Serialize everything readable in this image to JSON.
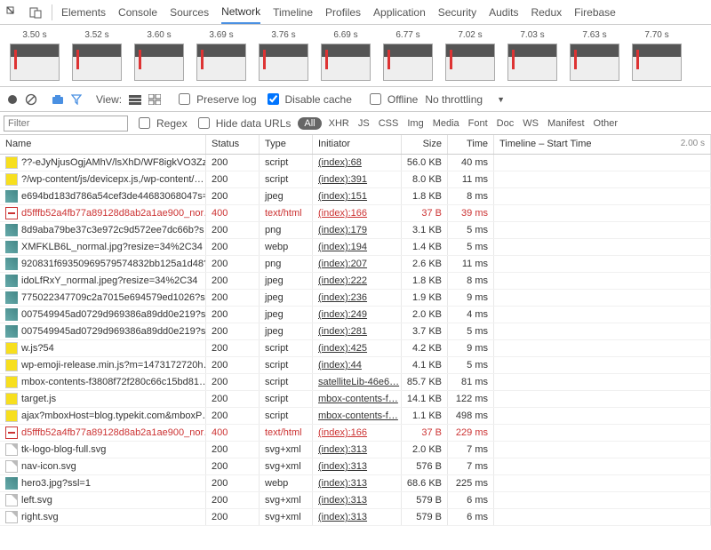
{
  "tabs": {
    "items": [
      "Elements",
      "Console",
      "Sources",
      "Network",
      "Timeline",
      "Profiles",
      "Application",
      "Security",
      "Audits",
      "Redux",
      "Firebase"
    ],
    "active": 3
  },
  "filmstrip": [
    {
      "t": "3.50 s"
    },
    {
      "t": "3.52 s"
    },
    {
      "t": "3.60 s"
    },
    {
      "t": "3.69 s"
    },
    {
      "t": "3.76 s"
    },
    {
      "t": "6.69 s"
    },
    {
      "t": "6.77 s"
    },
    {
      "t": "7.02 s"
    },
    {
      "t": "7.03 s"
    },
    {
      "t": "7.63 s"
    },
    {
      "t": "7.70 s"
    }
  ],
  "toolbar": {
    "view": "View:",
    "preserve": "Preserve log",
    "disable": "Disable cache",
    "offline": "Offline",
    "throttle": "No throttling",
    "disable_checked": true
  },
  "filter": {
    "placeholder": "Filter",
    "regex": "Regex",
    "hide": "Hide data URLs",
    "all": "All",
    "types": [
      "XHR",
      "JS",
      "CSS",
      "Img",
      "Media",
      "Font",
      "Doc",
      "WS",
      "Manifest",
      "Other"
    ]
  },
  "columns": {
    "name": "Name",
    "status": "Status",
    "type": "Type",
    "initiator": "Initiator",
    "size": "Size",
    "time": "Time",
    "timeline": "Timeline – Start Time",
    "tl_end": "2.00 s"
  },
  "rows": [
    {
      "icon": "js",
      "name": "??-eJyNjusOgjAMhV/lsXhD/WF8igkVO3Zz…",
      "status": "200",
      "type": "script",
      "init": "(index):68",
      "size": "56.0 KB",
      "time": "40 ms"
    },
    {
      "icon": "js",
      "name": "?/wp-content/js/devicepx.js,/wp-content/…",
      "status": "200",
      "type": "script",
      "init": "(index):391",
      "size": "8.0 KB",
      "time": "11 ms"
    },
    {
      "icon": "img",
      "name": "e694bd183d786a54cef3de44683068047s=…",
      "status": "200",
      "type": "jpeg",
      "init": "(index):151",
      "size": "1.8 KB",
      "time": "8 ms"
    },
    {
      "icon": "err",
      "name": "d5fffb52a4fb77a89128d8ab2a1ae900_nor…",
      "status": "400",
      "type": "text/html",
      "init": "(index):166",
      "size": "37 B",
      "time": "39 ms",
      "err": true
    },
    {
      "icon": "img",
      "name": "8d9aba79be37c3e972c9d572ee7dc66b?s…",
      "status": "200",
      "type": "png",
      "init": "(index):179",
      "size": "3.1 KB",
      "time": "5 ms"
    },
    {
      "icon": "img",
      "name": "XMFKLB6L_normal.jpg?resize=34%2C34",
      "status": "200",
      "type": "webp",
      "init": "(index):194",
      "size": "1.4 KB",
      "time": "5 ms"
    },
    {
      "icon": "img",
      "name": "920831f69350969579574832bb125a1d48?s=…",
      "status": "200",
      "type": "png",
      "init": "(index):207",
      "size": "2.6 KB",
      "time": "11 ms"
    },
    {
      "icon": "img",
      "name": "idoLfRxY_normal.jpeg?resize=34%2C34",
      "status": "200",
      "type": "jpeg",
      "init": "(index):222",
      "size": "1.8 KB",
      "time": "8 ms"
    },
    {
      "icon": "img",
      "name": "775022347709c2a7015e694579ed1026?s=…",
      "status": "200",
      "type": "jpeg",
      "init": "(index):236",
      "size": "1.9 KB",
      "time": "9 ms"
    },
    {
      "icon": "img",
      "name": "007549945ad0729d969386a89dd0e219?s…",
      "status": "200",
      "type": "jpeg",
      "init": "(index):249",
      "size": "2.0 KB",
      "time": "4 ms"
    },
    {
      "icon": "img",
      "name": "007549945ad0729d969386a89dd0e219?s…",
      "status": "200",
      "type": "jpeg",
      "init": "(index):281",
      "size": "3.7 KB",
      "time": "5 ms"
    },
    {
      "icon": "js",
      "name": "w.js?54",
      "status": "200",
      "type": "script",
      "init": "(index):425",
      "size": "4.2 KB",
      "time": "9 ms"
    },
    {
      "icon": "js",
      "name": "wp-emoji-release.min.js?m=1473172720h…",
      "status": "200",
      "type": "script",
      "init": "(index):44",
      "size": "4.1 KB",
      "time": "5 ms"
    },
    {
      "icon": "js",
      "name": "mbox-contents-f3808f72f280c66c15bd81…",
      "status": "200",
      "type": "script",
      "init": "satelliteLib-46e6…",
      "size": "85.7 KB",
      "time": "81 ms"
    },
    {
      "icon": "js",
      "name": "target.js",
      "status": "200",
      "type": "script",
      "init": "mbox-contents-f…",
      "size": "14.1 KB",
      "time": "122 ms"
    },
    {
      "icon": "js",
      "name": "ajax?mboxHost=blog.typekit.com&mboxP…",
      "status": "200",
      "type": "script",
      "init": "mbox-contents-f…",
      "size": "1.1 KB",
      "time": "498 ms"
    },
    {
      "icon": "err",
      "name": "d5fffb52a4fb77a89128d8ab2a1ae900_nor…",
      "status": "400",
      "type": "text/html",
      "init": "(index):166",
      "size": "37 B",
      "time": "229 ms",
      "err": true
    },
    {
      "icon": "doc",
      "name": "tk-logo-blog-full.svg",
      "status": "200",
      "type": "svg+xml",
      "init": "(index):313",
      "size": "2.0 KB",
      "time": "7 ms"
    },
    {
      "icon": "doc",
      "name": "nav-icon.svg",
      "status": "200",
      "type": "svg+xml",
      "init": "(index):313",
      "size": "576 B",
      "time": "7 ms"
    },
    {
      "icon": "img",
      "name": "hero3.jpg?ssl=1",
      "status": "200",
      "type": "webp",
      "init": "(index):313",
      "size": "68.6 KB",
      "time": "225 ms"
    },
    {
      "icon": "doc",
      "name": "left.svg",
      "status": "200",
      "type": "svg+xml",
      "init": "(index):313",
      "size": "579 B",
      "time": "6 ms"
    },
    {
      "icon": "doc",
      "name": "right.svg",
      "status": "200",
      "type": "svg+xml",
      "init": "(index):313",
      "size": "579 B",
      "time": "6 ms"
    }
  ]
}
